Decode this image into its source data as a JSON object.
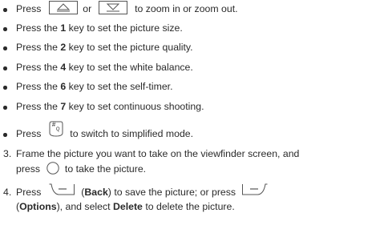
{
  "bullets": {
    "zoom": {
      "pre": "Press",
      "mid": "or",
      "post": "to zoom in or zoom out."
    },
    "k1": {
      "pre": "Press the",
      "key": "1",
      "post": "key to set the picture size."
    },
    "k2": {
      "pre": "Press the",
      "key": "2",
      "post": "key to set the picture quality."
    },
    "k4": {
      "pre": "Press the",
      "key": "4",
      "post": "key to set the white balance."
    },
    "k6": {
      "pre": "Press the",
      "key": "6",
      "post": "key to set the self-timer."
    },
    "k7": {
      "pre": "Press the",
      "key": "7",
      "post": "key to set continuous shooting."
    },
    "hash": {
      "pre": "Press",
      "post": "to switch to simplified mode.",
      "key_label": "#",
      "key_sub": "Q"
    }
  },
  "steps": [
    {
      "number": "3.",
      "line1": "Frame the picture you want to take on the viewfinder screen, and",
      "line2_pre": "press",
      "line2_post": "to take the picture."
    },
    {
      "number": "4.",
      "line1_pre": "Press",
      "line1_back_open": "(",
      "line1_back": "Back",
      "line1_back_close": ")",
      "line1_mid": "to save the picture; or press",
      "line2_open": "(",
      "line2_options": "Options",
      "line2_close": "), and select",
      "line2_delete": "Delete",
      "line2_post": "to delete the picture."
    }
  ],
  "icons": [
    "up-key-icon",
    "down-key-icon",
    "hash-key-icon",
    "ok-key-icon",
    "left-soft-key-icon",
    "right-soft-key-icon"
  ]
}
